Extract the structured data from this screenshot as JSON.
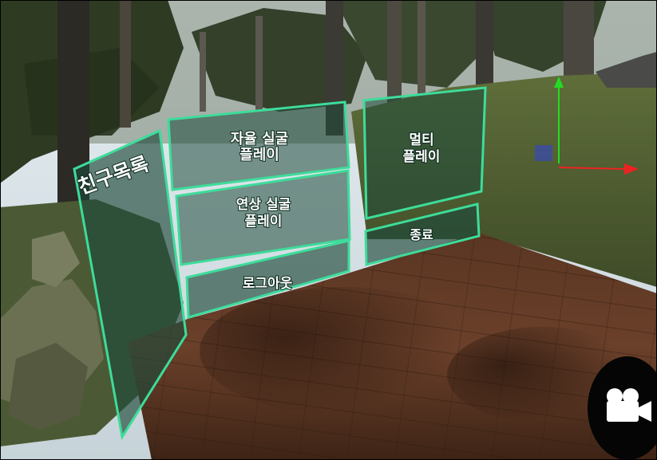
{
  "menu": {
    "friends_list": "친구목록",
    "solo_play_line1": "자율 실굴",
    "solo_play_line2": "플레이",
    "guided_play_line1": "연상 실굴",
    "guided_play_line2": "플레이",
    "logout": "로그아웃",
    "multi_line1": "멀티",
    "multi_line2": "플레이",
    "exit": "종료"
  },
  "colors": {
    "panel_border": "#3ddc9a",
    "panel_fill": "#1f4a3a",
    "axis_y": "#22dd22",
    "axis_x": "#ee2222",
    "axis_z": "#3344cc"
  },
  "icons": {
    "record": "video-camera-icon"
  }
}
